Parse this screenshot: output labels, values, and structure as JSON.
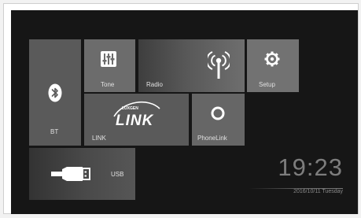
{
  "tiles": {
    "bt": {
      "label": "BT",
      "icon": "bluetooth-icon"
    },
    "tone": {
      "label": "Tone",
      "icon": "equalizer-icon"
    },
    "radio": {
      "label": "Radio",
      "icon": "radio-antenna-icon"
    },
    "setup": {
      "label": "Setup",
      "icon": "gear-icon"
    },
    "link": {
      "label": "LINK",
      "logo_text": "LINK",
      "logo_small_text": "LUXGEN",
      "icon": "link-logo"
    },
    "phonelink": {
      "label": "PhoneLink",
      "icon": "ring-icon"
    },
    "usb": {
      "label": "USB",
      "icon": "usb-plug-icon"
    }
  },
  "clock": {
    "time": "19:23",
    "date": "2016/10/11 Tuesday"
  },
  "colors": {
    "background": "#161616",
    "tile_light": "#727272",
    "tile_mid": "#666666",
    "tile_dark": "#5a5a5a",
    "clock_text": "#7d7d7d"
  }
}
